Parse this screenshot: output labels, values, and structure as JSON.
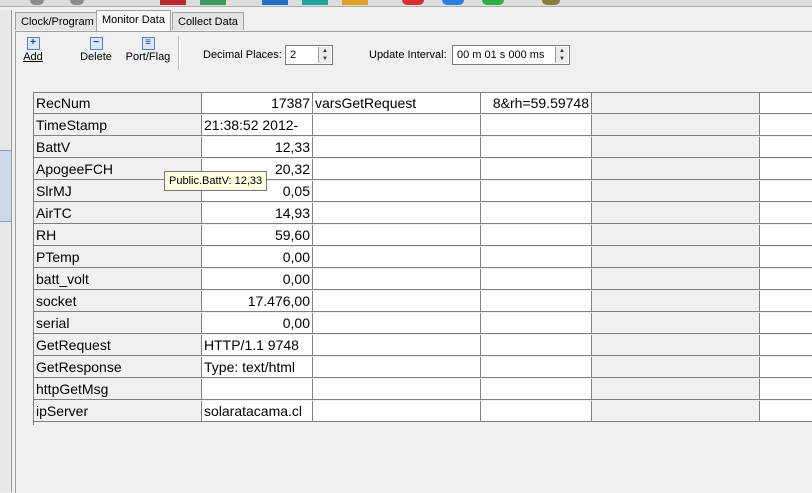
{
  "tabs": [
    "Clock/Program",
    "Monitor Data",
    "Collect Data"
  ],
  "toolbar": {
    "add_label": "Add",
    "delete_label": "Delete",
    "portflag_label": "Port/Flag",
    "decimal_places_label": "Decimal Places:",
    "decimal_places_value": "2",
    "update_interval_label": "Update Interval:",
    "update_interval_value": "00 m 01 s 000 ms"
  },
  "grid": {
    "rows": [
      {
        "name": "RecNum",
        "value": "17387",
        "name2": "varsGetRequest",
        "value2": "8&rh=59.59748"
      },
      {
        "name": "TimeStamp",
        "value": "-2012 21:38:52",
        "name2": "",
        "value2": ""
      },
      {
        "name": "BattV",
        "value": "12,33",
        "name2": "",
        "value2": ""
      },
      {
        "name": "ApogeeFCH",
        "value": "20,32",
        "name2": "",
        "value2": ""
      },
      {
        "name": "SlrMJ",
        "value": "0,05",
        "name2": "",
        "value2": ""
      },
      {
        "name": "AirTC",
        "value": "14,93",
        "name2": "",
        "value2": ""
      },
      {
        "name": "RH",
        "value": "59,60",
        "name2": "",
        "value2": ""
      },
      {
        "name": "PTemp",
        "value": "0,00",
        "name2": "",
        "value2": ""
      },
      {
        "name": "batt_volt",
        "value": "0,00",
        "name2": "",
        "value2": ""
      },
      {
        "name": "socket",
        "value": "17.476,00",
        "name2": "",
        "value2": ""
      },
      {
        "name": "serial",
        "value": "0,00",
        "name2": "",
        "value2": ""
      },
      {
        "name": "GetRequest",
        "value": "9748 HTTP/1.1",
        "name2": "",
        "value2": ""
      },
      {
        "name": "GetResponse",
        "value": "Type: text/html",
        "name2": "",
        "value2": ""
      },
      {
        "name": "httpGetMsg",
        "value": "",
        "name2": "",
        "value2": ""
      },
      {
        "name": "ipServer",
        "value": "solaratacama.cl",
        "name2": "",
        "value2": ""
      }
    ]
  },
  "tooltip": "Public.BattV: 12,33"
}
